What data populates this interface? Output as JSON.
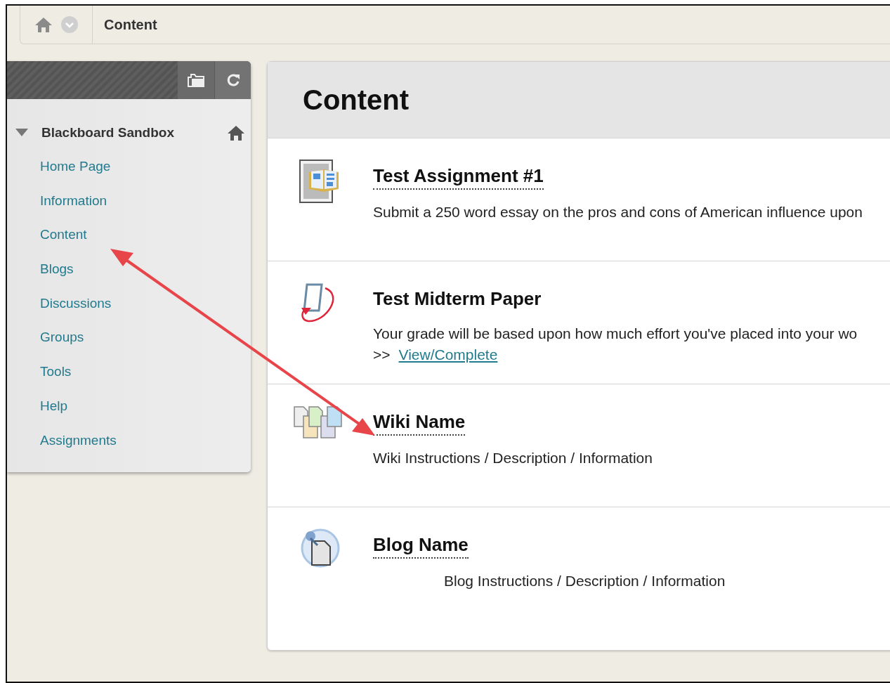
{
  "breadcrumb": {
    "current": "Content"
  },
  "sidebar": {
    "course": {
      "title": "Blackboard Sandbox",
      "expanded": true
    },
    "items": [
      {
        "label": "Home Page"
      },
      {
        "label": "Information"
      },
      {
        "label": "Content"
      },
      {
        "label": "Blogs"
      },
      {
        "label": "Discussions"
      },
      {
        "label": "Groups"
      },
      {
        "label": "Tools"
      },
      {
        "label": "Help"
      },
      {
        "label": "Assignments"
      }
    ]
  },
  "content": {
    "title": "Content",
    "items": [
      {
        "kind": "assignment",
        "title": "Test Assignment #1",
        "underlined": true,
        "description": "Submit a 250 word essay on the pros and cons of American influence upon",
        "indented": false
      },
      {
        "kind": "paper",
        "title": "Test Midterm Paper",
        "underlined": false,
        "description": "Your grade will be based upon how much effort you've placed into your wo",
        "indented": false,
        "action": {
          "prefix": ">>",
          "link": "View/Complete"
        }
      },
      {
        "kind": "wiki",
        "title": "Wiki Name",
        "underlined": true,
        "description": "Wiki Instructions / Description / Information",
        "indented": false
      },
      {
        "kind": "blog",
        "title": "Blog Name",
        "underlined": true,
        "description": "Blog Instructions / Description / Information",
        "indented": true
      }
    ]
  }
}
